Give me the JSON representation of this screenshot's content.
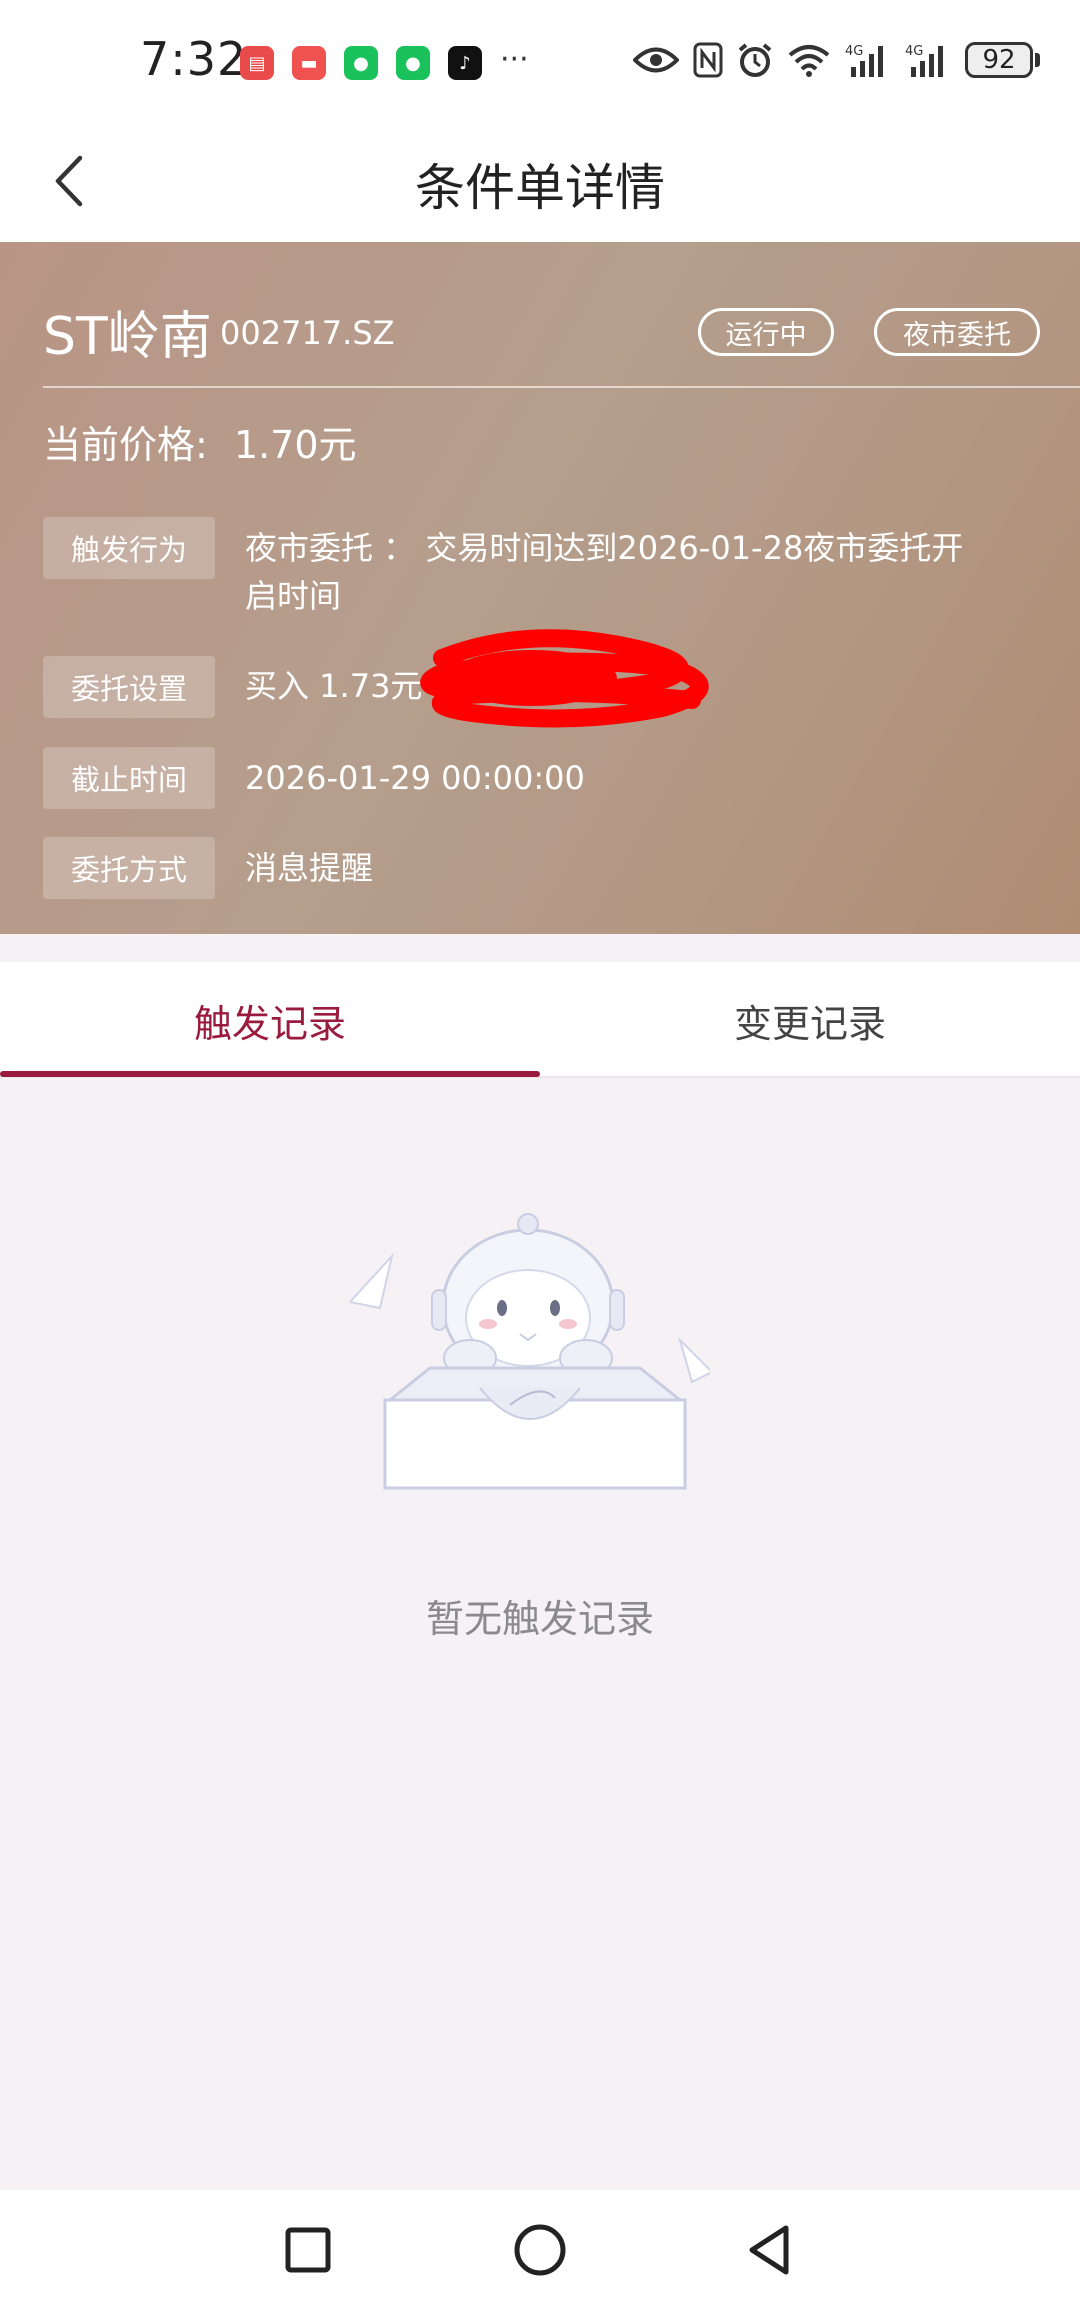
{
  "status_bar": {
    "time": "7:32",
    "more": "···",
    "battery": "92",
    "icons": [
      "huawei-appgallery-icon",
      "huawei-icon",
      "wechat-icon",
      "wechat-icon",
      "tiktok-icon",
      "eye-icon",
      "nfc-icon",
      "alarm-icon",
      "wifi-icon",
      "signal-4g-icon",
      "signal-4g-icon"
    ]
  },
  "nav": {
    "title": "条件单详情"
  },
  "order": {
    "stock_name": "ST岭南",
    "stock_code": "002717.SZ",
    "status_badge": "运行中",
    "type_badge": "夜市委托",
    "price_label": "当前价格:",
    "price_value": "1.70元",
    "rows": [
      {
        "label": "触发行为",
        "value_line1": "夜市委托 ： 交易时间达到2026-01-28夜市委托开",
        "value_line2": "启时间"
      },
      {
        "label": "委托设置",
        "value": "买入  1.73元  /"
      },
      {
        "label": "截止时间",
        "value": "2026-01-29  00:00:00"
      },
      {
        "label": "委托方式",
        "value": "消息提醒"
      }
    ]
  },
  "tabs": [
    {
      "label": "触发记录",
      "active": true
    },
    {
      "label": "变更记录",
      "active": false
    }
  ],
  "empty": {
    "message": "暂无触发记录"
  },
  "colors": {
    "accent": "#9b1b3e",
    "card_bg": "#b59e8d",
    "redaction": "#ff0000"
  }
}
